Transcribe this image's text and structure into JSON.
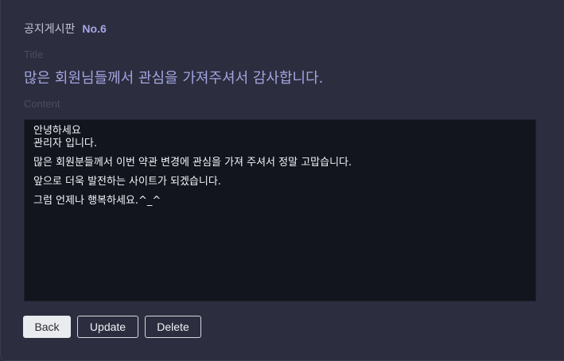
{
  "board": {
    "name": "공지게시판",
    "number": "No.6"
  },
  "post": {
    "title_label": "Title",
    "title": "많은 회원님들께서 관심을 가져주셔서 감사합니다.",
    "content_label": "Content",
    "content_lines": [
      "안녕하세요",
      "관리자 입니다.",
      "많은 회원분들께서 이번 약관 변경에 관심을 가져 주셔서 정말 고맙습니다.",
      "앞으로 더욱 발전하는 사이트가 되겠습니다.",
      "그럼 언제나 행복하세요.^_^"
    ]
  },
  "actions": {
    "back_label": "Back",
    "update_label": "Update",
    "delete_label": "Delete"
  },
  "colors": {
    "background": "#2c2d3e",
    "accent": "#a3a5e0",
    "content_bg": "#12151e"
  }
}
